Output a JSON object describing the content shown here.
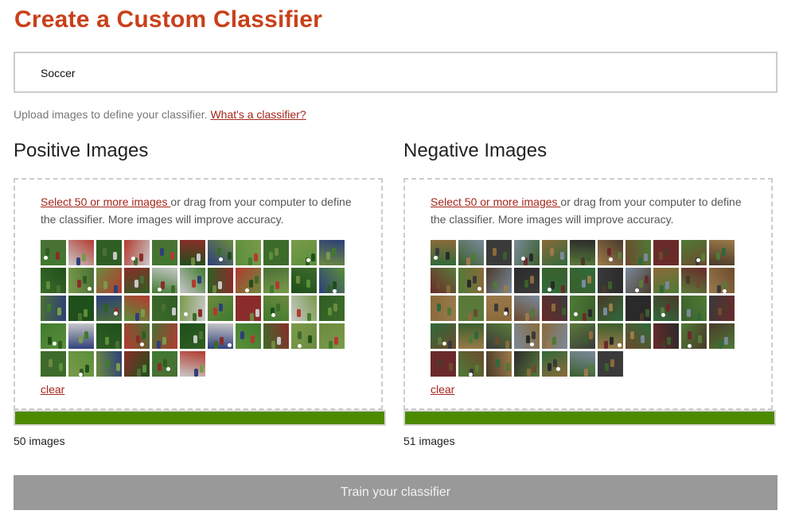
{
  "page": {
    "title": "Create a Custom Classifier",
    "classifier_name_value": "Soccer",
    "hint_text": "Upload images to define your classifier. ",
    "hint_link": "What's a classifier?"
  },
  "positive": {
    "title": "Positive Images",
    "select_link": "Select 50 or more images ",
    "instructions": "or drag from your computer to define the classifier. More images will improve accuracy.",
    "clear_label": "clear",
    "count_label": "50 images",
    "image_count": 50,
    "progress_fraction": 1.0,
    "thumb_palette": [
      "#3f7a2e",
      "#5a8f3a",
      "#2f5e23",
      "#7a9a4b",
      "#4a6f35",
      "#8a2d2a",
      "#2e3f7a",
      "#c8c8c8",
      "#3d6b2b",
      "#b33a2f",
      "#6c8a3f",
      "#1f4f1a"
    ]
  },
  "negative": {
    "title": "Negative Images",
    "select_link": "Select 50 or more images ",
    "instructions": "or drag from your computer to define the classifier. More images will improve accuracy.",
    "clear_label": "clear",
    "count_label": "51 images",
    "image_count": 51,
    "progress_fraction": 1.0,
    "thumb_palette": [
      "#2f6a3a",
      "#6b4a2e",
      "#3a3a3a",
      "#4f7a35",
      "#8a6a3a",
      "#2a2a2a",
      "#9a7a4a",
      "#3b5f2c",
      "#6a2a2a",
      "#7a8a9a",
      "#4a3a2a",
      "#5a7a3a"
    ]
  },
  "colors": {
    "title": "#c8401a",
    "link": "#a5261a",
    "progress": "#4d8a00",
    "button": "#999999"
  },
  "train_button": "Train your classifier"
}
